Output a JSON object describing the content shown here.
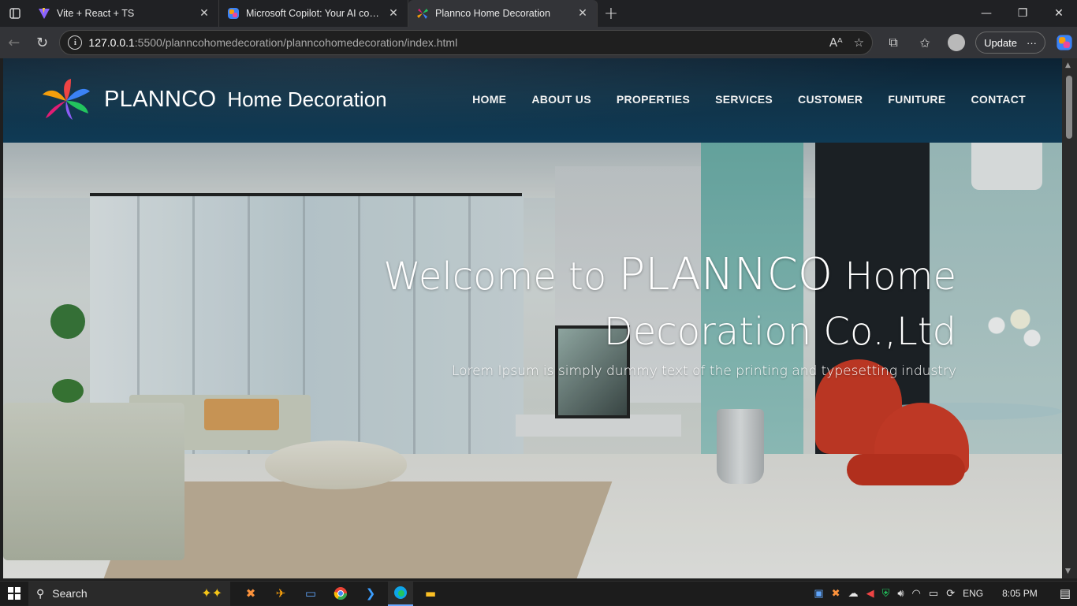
{
  "browser": {
    "tabs": [
      {
        "title": "Vite + React + TS",
        "active": false
      },
      {
        "title": "Microsoft Copilot: Your AI companion",
        "active": false
      },
      {
        "title": "Plannco Home Decoration",
        "active": true
      }
    ],
    "address": {
      "host": "127.0.0.1",
      "path": ":5500/planncohomedecoration/planncohomedecoration/index.html"
    },
    "update_label": "Update",
    "more_label": "···"
  },
  "site": {
    "brand": "PLANNCO",
    "brand_sub": "Home Decoration",
    "nav": [
      "HOME",
      "ABOUT US",
      "PROPERTIES",
      "SERVICES",
      "CUSTOMER",
      "FUNITURE",
      "CONTACT"
    ],
    "hero": {
      "title_prefix": "Welcome to ",
      "title_brand": "PLANNCO",
      "title_suffix": " Home Decoration Co.,Ltd",
      "subtitle": "Lorem Ipsum is simply dummy text of the printing and typesetting industry"
    }
  },
  "taskbar": {
    "search_placeholder": "Search",
    "language": "ENG",
    "time": "8:05 PM"
  },
  "colors": {
    "header_bg": "#0f3a55",
    "chrome_bg": "#202124",
    "accent": "#6aa8ff"
  }
}
